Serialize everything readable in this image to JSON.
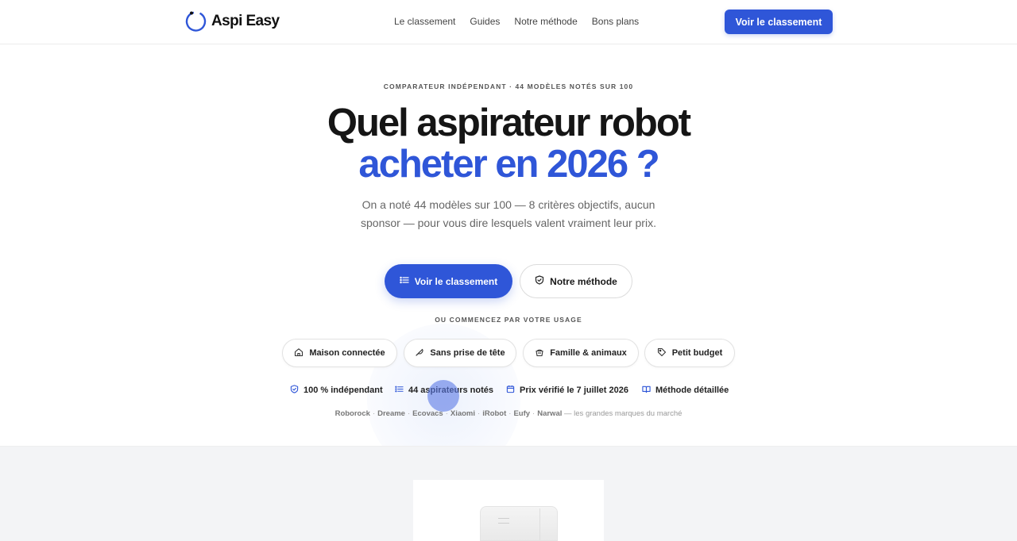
{
  "header": {
    "brand": "Aspi Easy",
    "nav": [
      "Le classement",
      "Guides",
      "Notre méthode",
      "Bons plans"
    ],
    "cta": "Voir le classement",
    "accent": "#2f56d8"
  },
  "hero": {
    "eyebrow": "COMPARATEUR INDÉPENDANT · 44 MODÈLES NOTÉS SUR 100",
    "title_line1": "Quel aspirateur robot",
    "title_line2": "acheter en 2026 ?",
    "lead": "On a noté 44 modèles sur 100 — 8 critères objectifs, aucun sponsor — pour vous dire lesquels valent vraiment leur prix.",
    "primary_cta": "Voir le classement",
    "primary_icon": "list-icon",
    "secondary_cta": "Notre méthode",
    "secondary_icon": "shield-icon"
  },
  "usage": {
    "label": "OU COMMENCEZ PAR VOTRE USAGE",
    "chips": [
      {
        "label": "Maison connectée",
        "icon": "home-icon"
      },
      {
        "label": "Sans prise de tête",
        "icon": "feather-icon"
      },
      {
        "label": "Famille & animaux",
        "icon": "paw-icon"
      },
      {
        "label": "Petit budget",
        "icon": "tag-icon"
      }
    ]
  },
  "trust": [
    {
      "label": "100 % indépendant",
      "icon": "shield-icon"
    },
    {
      "label": "44 aspirateurs notés",
      "icon": "list-icon"
    },
    {
      "label": "Prix vérifié le 7 juillet 2026",
      "icon": "calendar-icon"
    },
    {
      "label": "Méthode détaillée",
      "icon": "book-icon"
    }
  ],
  "brands": {
    "names": [
      "Roborock",
      "Dreame",
      "Ecovacs",
      "Xiaomi",
      "iRobot",
      "Eufy",
      "Narwal"
    ],
    "tail": "— les grandes marques du marché"
  }
}
